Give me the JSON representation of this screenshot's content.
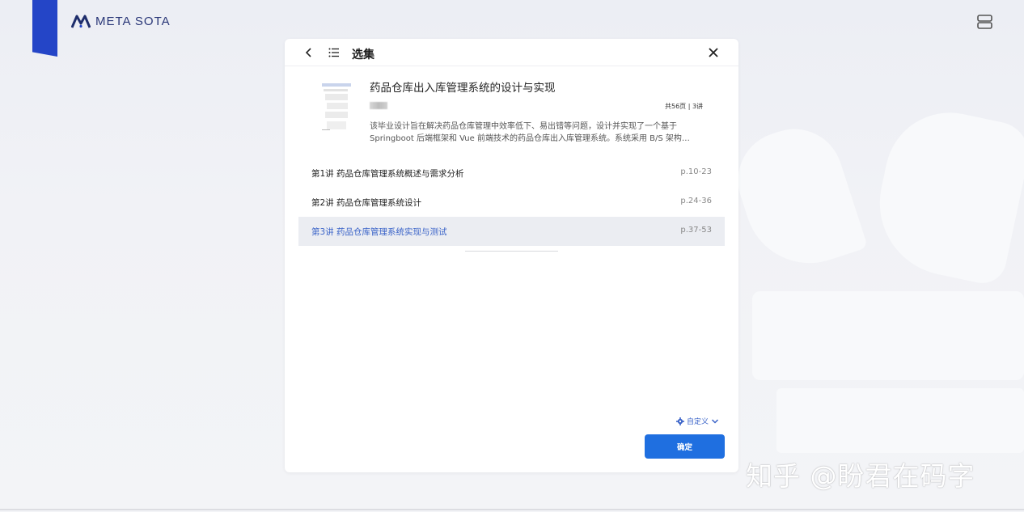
{
  "brand": {
    "name": "META SOTA",
    "color": "#2445c7"
  },
  "header": {
    "menu_icon": "menu-icon"
  },
  "modal": {
    "title": "选集",
    "back_icon": "chevron-left-icon",
    "list_icon": "list-icon",
    "close_icon": "close-icon",
    "document": {
      "title": "药品仓库出入库管理系统的设计与实现",
      "meta": "共56页 | 3讲",
      "description": "该毕业设计旨在解决药品仓库管理中效率低下、易出错等问题，设计并实现了一个基于 Springboot 后端框架和 Vue 前端技术的药品仓库出入库管理系统。系统采用 B/S 架构…"
    },
    "chapters": [
      {
        "title": "第1讲 药品仓库管理系统概述与需求分析",
        "pages": "p.10-23",
        "active": false
      },
      {
        "title": "第2讲 药品仓库管理系统设计",
        "pages": "p.24-36",
        "active": false
      },
      {
        "title": "第3讲 药品仓库管理系统实现与测试",
        "pages": "p.37-53",
        "active": true
      }
    ],
    "customize_label": "自定义",
    "confirm_label": "确定",
    "accent_color": "#1f6fe0",
    "active_color": "#3a63c8"
  },
  "watermark": "知乎 @盼君在码字"
}
